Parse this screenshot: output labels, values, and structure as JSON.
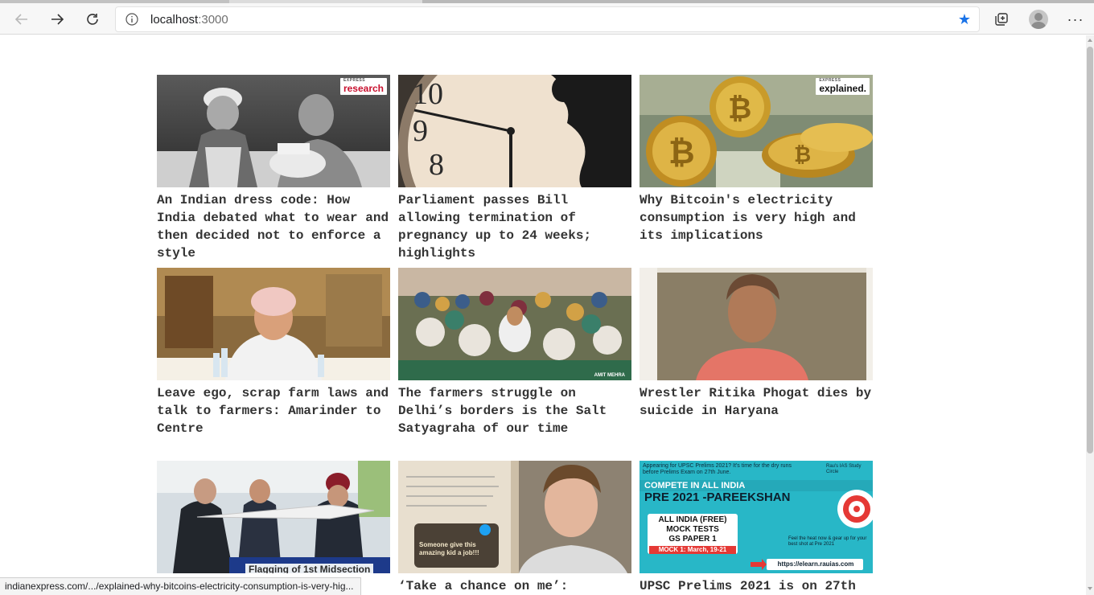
{
  "browser": {
    "url_host": "localhost",
    "url_port": ":3000",
    "status_url": "indianexpress.com/.../explained-why-bitcoins-electricity-consumption-is-very-hig..."
  },
  "icons": {
    "back": "arrow-left-icon",
    "forward": "arrow-right-icon",
    "reload": "reload-icon",
    "info": "info-icon",
    "favorite": "star-icon",
    "collections": "collections-icon",
    "profile": "avatar-icon",
    "menu": "more-icon"
  },
  "colors": {
    "star": "#1a73e8",
    "title_text": "#333333",
    "express_red": "#c8102e"
  },
  "articles": [
    {
      "title": "An Indian dress code: How India debated what to wear and then decided not to enforce a style",
      "badge_top": "EXPRESS",
      "badge": "research"
    },
    {
      "title": "Parliament passes Bill allowing termination of pregnancy up to 24 weeks; highlights"
    },
    {
      "title": "Why Bitcoin's electricity consumption is very high and its implications",
      "badge_top": "EXPRESS",
      "badge": "explained."
    },
    {
      "title": "Leave ego, scrap farm laws and talk to farmers: Amarinder to Centre"
    },
    {
      "title": "The farmers struggle on Delhi’s borders is the Salt Satyagraha of our time",
      "credit": "AMIT MEHRA"
    },
    {
      "title": "Wrestler Ritika Phogat dies by suicide in Haryana"
    },
    {
      "title": "",
      "caption": "Flagging of 1st Midsection"
    },
    {
      "title": "‘Take a chance on me’:",
      "tweet": "Someone give this amazing kid a job!!!"
    },
    {
      "title": "UPSC Prelims 2021 is on 27th",
      "ad": {
        "top": "Appearing for UPSC Prelims 2021? It's time for the dry runs before Prelims Exam on 27th June.",
        "brand": "Rau's IAS Study Circle",
        "line1": "COMPETE IN ALL INDIA",
        "line2": "PRE 2021 -PAREEKSHAN",
        "box1": "ALL INDIA (FREE)",
        "box2": "MOCK TESTS",
        "box3": "GS PAPER 1",
        "mock": "MOCK 1: March, 19-21",
        "cta": "Feel the heat now & gear up for your best shot at Pre 2021",
        "url": "https://elearn.rauias.com"
      }
    }
  ]
}
